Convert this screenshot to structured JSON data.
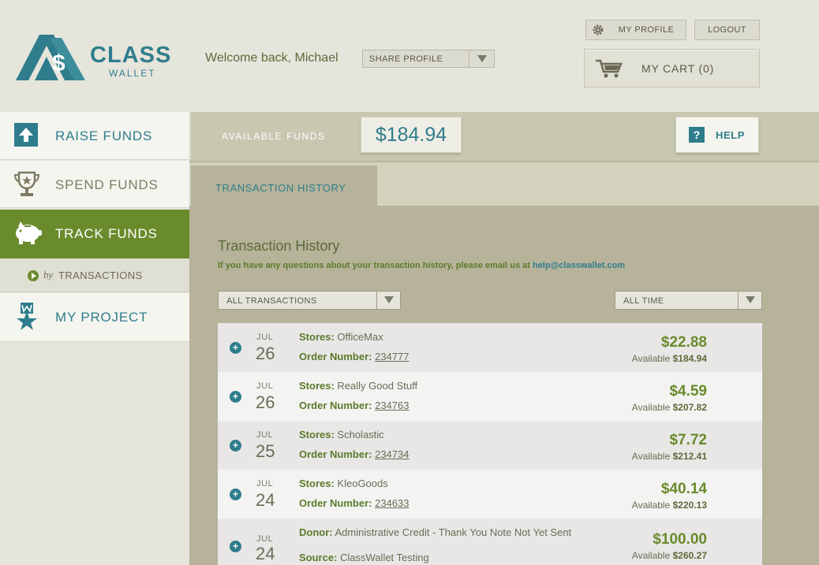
{
  "header": {
    "logo_text_main": "CLASS",
    "logo_text_sub": "WALLET",
    "welcome": "Welcome back, Michael",
    "share_profile": "SHARE PROFILE",
    "my_profile": "MY PROFILE",
    "logout": "LOGOUT",
    "cart": "MY CART (0)"
  },
  "sidebar": {
    "items": [
      {
        "label": "RAISE FUNDS",
        "icon": "upload-arrow-icon"
      },
      {
        "label": "SPEND FUNDS",
        "icon": "trophy-icon"
      },
      {
        "label": "TRACK FUNDS",
        "icon": "piggy-bank-icon"
      },
      {
        "label": "MY PROJECT",
        "icon": "ribbon-star-icon"
      }
    ],
    "sub_by": "by",
    "sub_label": "TRANSACTIONS"
  },
  "funds": {
    "label": "AVAILABLE FUNDS",
    "value": "$184.94",
    "help": "HELP"
  },
  "tabs": {
    "active": "TRANSACTION HISTORY"
  },
  "main": {
    "title": "Transaction History",
    "subtitle": "If you have any questions about your transaction history, please email us at",
    "email": "help@classwallet.com",
    "filter_type": "ALL TRANSACTIONS",
    "filter_time": "ALL TIME"
  },
  "transactions": [
    {
      "month": "JUL",
      "day": "26",
      "k1": "Stores:",
      "v1": "OfficeMax",
      "k2": "Order Number:",
      "v2": "234777",
      "amount": "$22.88",
      "avail_label": "Available",
      "avail": "$184.94"
    },
    {
      "month": "JUL",
      "day": "26",
      "k1": "Stores:",
      "v1": "Really Good Stuff",
      "k2": "Order Number:",
      "v2": "234763",
      "amount": "$4.59",
      "avail_label": "Available",
      "avail": "$207.82"
    },
    {
      "month": "JUL",
      "day": "25",
      "k1": "Stores:",
      "v1": "Scholastic",
      "k2": "Order Number:",
      "v2": "234734",
      "amount": "$7.72",
      "avail_label": "Available",
      "avail": "$212.41"
    },
    {
      "month": "JUL",
      "day": "24",
      "k1": "Stores:",
      "v1": "KleoGoods",
      "k2": "Order Number:",
      "v2": "234633",
      "amount": "$40.14",
      "avail_label": "Available",
      "avail": "$220.13"
    },
    {
      "month": "JUL",
      "day": "24",
      "k1": "Donor:",
      "v1": "Administrative Credit - Thank You Note Not Yet Sent",
      "k2": "Source:",
      "v2": "ClassWallet Testing",
      "amount": "$100.00",
      "avail_label": "Available",
      "avail": "$260.27"
    }
  ],
  "colors": {
    "teal": "#2f7d8c",
    "green": "#6a8b2c",
    "olive_bg": "#b6b39a",
    "header_bg": "#e6e5dc"
  }
}
